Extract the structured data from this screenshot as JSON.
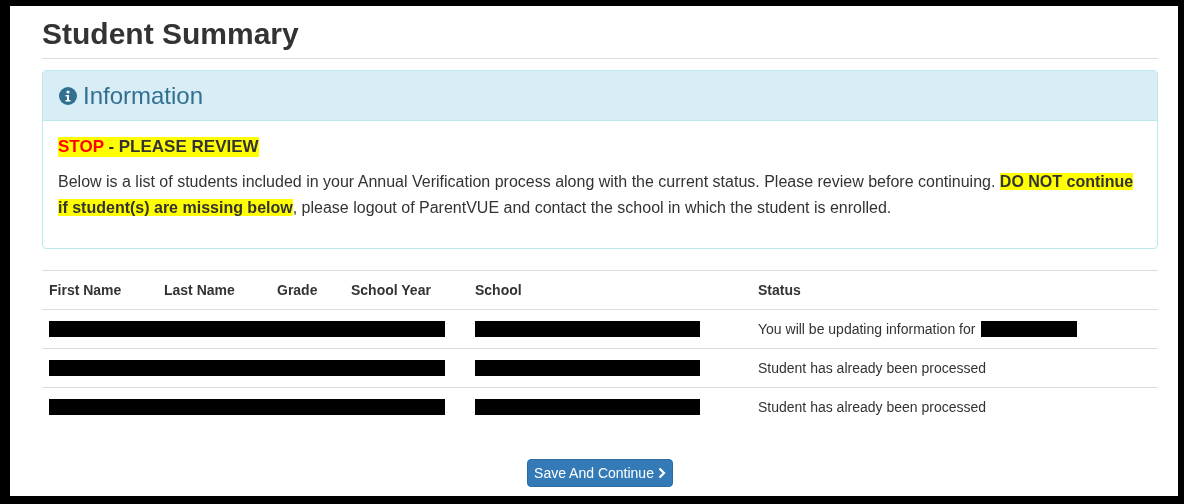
{
  "title": "Student Summary",
  "info_panel": {
    "heading": "Information",
    "alert": "*STOP* - PLEASE REVIEW",
    "message": "Below is a list of students included in your Annual Verification process along with the current status. Please review before continuing. **DO NOT continue if student(s) are missing below**, please logout of ParentVUE and contact the school in which the student is enrolled."
  },
  "table": {
    "columns": [
      "First Name",
      "Last Name",
      "Grade",
      "School Year",
      "School",
      "Status"
    ],
    "rows": [
      {
        "name_redacted": true,
        "school_redacted": true,
        "status": "You will be updating information for",
        "status_redacted": true
      },
      {
        "name_redacted": true,
        "school_redacted": true,
        "status": "Student has already been processed",
        "status_redacted": false
      },
      {
        "name_redacted": true,
        "school_redacted": true,
        "status": "Student has already been processed",
        "status_redacted": false
      }
    ]
  },
  "button": {
    "label": "Save And Continue"
  }
}
